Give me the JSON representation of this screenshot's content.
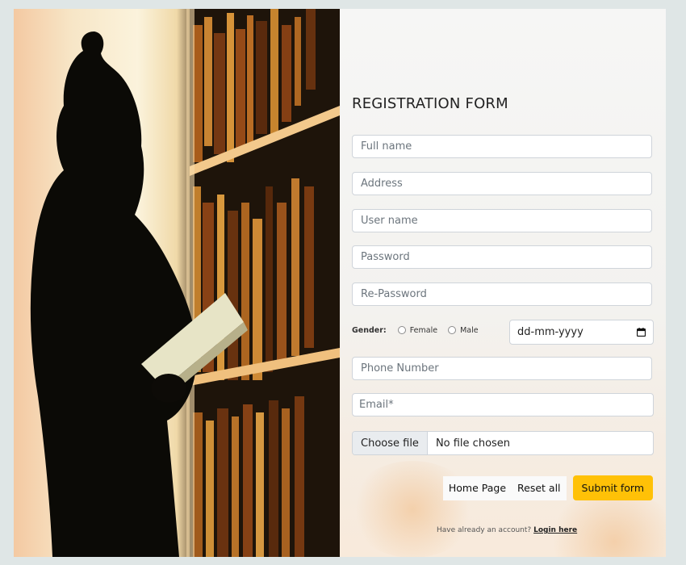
{
  "form": {
    "title": "REGISTRATION FORM",
    "full_name_placeholder": "Full name",
    "address_placeholder": "Address",
    "username_placeholder": "User name",
    "password_placeholder": "Password",
    "repassword_placeholder": "Re-Password",
    "gender_label": "Gender:",
    "gender_options": [
      "Female",
      "Male"
    ],
    "date_value": "dd-mm-yyyy",
    "phone_placeholder": "Phone Number",
    "email_placeholder": "Email*",
    "file_button": "Choose file",
    "file_status": "No file chosen",
    "home_button": "Home Page",
    "reset_button": "Reset all",
    "submit_button": "Submit form",
    "login_prompt": "Have already an account?",
    "login_link": "Login here"
  },
  "colors": {
    "page_bg": "#dfe6e6",
    "submit_bg": "#ffc107",
    "file_button_bg": "#e9ecef"
  },
  "icons": {
    "calendar": "calendar-icon"
  }
}
